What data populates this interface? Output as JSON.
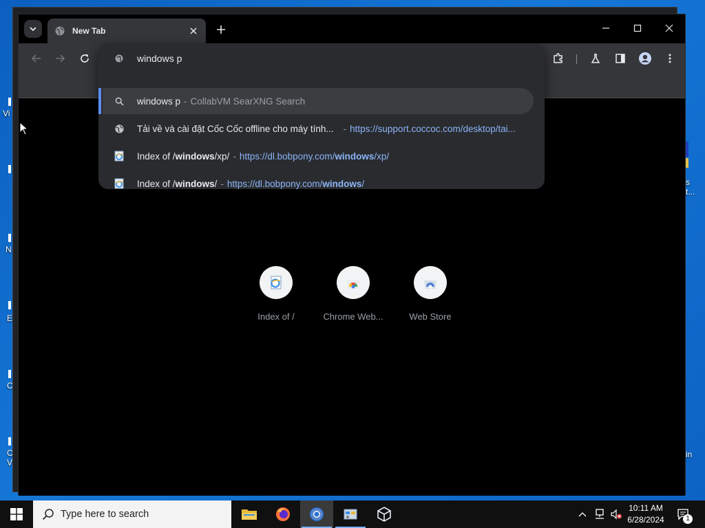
{
  "desktop": {
    "fragments_left": [
      "Vi",
      "N",
      "E",
      "C",
      "C",
      "V"
    ],
    "fragments_right": [
      "s",
      "t...",
      "in"
    ]
  },
  "browser": {
    "tab": {
      "title": "New Tab"
    },
    "omnibox": {
      "input_value": "windows p",
      "suggestions": [
        {
          "type": "search",
          "icon": "search-icon",
          "text": "windows p",
          "dash": "-",
          "source": "CollabVM SearXNG Search"
        },
        {
          "type": "history",
          "icon": "globe-icon",
          "text": "Tải về và cài đặt Cốc Cốc offline cho máy tính...",
          "dash": "-",
          "url": "https://support.coccoc.com/desktop/tai..."
        },
        {
          "type": "history",
          "icon": "ie-page-icon",
          "text_pre": "Index of /",
          "text_bold": "windows",
          "text_post": "/xp/",
          "dash": "-",
          "url_pre": "https://dl.bobpony.com/",
          "url_bold": "windows",
          "url_post": "/xp/"
        },
        {
          "type": "history",
          "icon": "ie-page-icon",
          "text_pre": "Index of /",
          "text_bold": "windows",
          "text_post": "/",
          "dash": "-",
          "url_pre": "https://dl.bobpony.com/",
          "url_bold": "windows",
          "url_post": "/"
        }
      ]
    },
    "shortcuts": [
      {
        "label": "Index of /",
        "icon": "ie-page-icon"
      },
      {
        "label": "Chrome Web...",
        "icon": "chrome-web-store-icon"
      },
      {
        "label": "Web Store",
        "icon": "web-store-icon"
      }
    ]
  },
  "taskbar": {
    "search_placeholder": "Type here to search",
    "apps": [
      "file-explorer",
      "firefox",
      "chrome",
      "control-panel",
      "virtualbox"
    ],
    "clock": {
      "time": "10:11 AM",
      "date": "6/28/2024"
    },
    "notification_count": "1"
  },
  "colors": {
    "desktop": "#1577d6",
    "omnibox_bg": "#2a2b2e",
    "link": "#8ab4f8",
    "selection_bar": "#5b8ef0"
  }
}
